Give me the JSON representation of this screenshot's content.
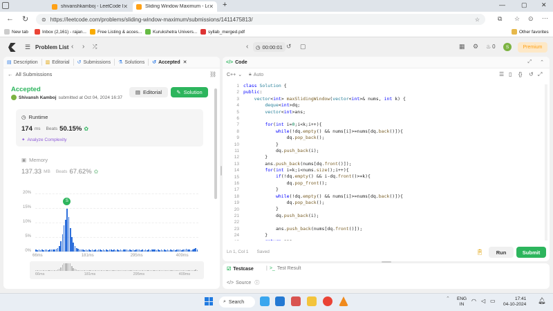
{
  "browser": {
    "tabs": [
      {
        "title": "shivanshkamboj - LeetCode Profi",
        "active": false
      },
      {
        "title": "Sliding Window Maximum - Leetc",
        "active": true
      }
    ],
    "new_tab": "+",
    "url": "https://leetcode.com/problems/sliding-window-maximum/submissions/1411475813/",
    "bookmarks": [
      "New tab",
      "Inbox (2,161) - rajan...",
      "Free Listing & acces...",
      "Kurukshetra Univers...",
      "syllab_merged.pdf"
    ],
    "other_favorites": "Other favorites"
  },
  "lc_header": {
    "problem_list": "Problem List",
    "timer": "00:00:01",
    "coins": "0",
    "premium": "Premium",
    "avatar_letter": "S"
  },
  "left_tabs": [
    "Description",
    "Editorial",
    "Submissions",
    "Solutions",
    "Accepted"
  ],
  "submission": {
    "back_link": "All Submissions",
    "status": "Accepted",
    "user": "Shivansh Kamboj",
    "submitted_at": "submitted at Oct 04, 2024 16:37",
    "editorial_button": "Editorial",
    "solution_button": "Solution",
    "runtime_label": "Runtime",
    "runtime_value": "174",
    "runtime_unit": "ms",
    "beats_label": "Beats",
    "runtime_beats": "50.15%",
    "analyze": "Analyze Complexity",
    "memory_label": "Memory",
    "memory_value": "137.33",
    "memory_unit": "MB",
    "memory_beats": "67.62%"
  },
  "chart_data": {
    "type": "bar",
    "y_ticks": [
      "20%",
      "15%",
      "10%",
      "5%",
      "0%"
    ],
    "x_ticks": [
      "66ms",
      "181ms",
      "295ms",
      "409ms"
    ],
    "mini_x_ticks": [
      "66ms",
      "181ms",
      "295ms",
      "409ms"
    ],
    "ylim": [
      0,
      20
    ],
    "marker_label": "S",
    "values": [
      0.6,
      0.5,
      0.6,
      0.5,
      0.6,
      0.5,
      0.7,
      0.6,
      0.5,
      0.6,
      0.7,
      0.6,
      0.8,
      0.9,
      1.2,
      2,
      3.5,
      6,
      9,
      11,
      14.8,
      12,
      8,
      5,
      3,
      1.8,
      1.2,
      0.9,
      0.8,
      0.6,
      0.7,
      0.5,
      0.6,
      0.5,
      0.6,
      0.5,
      0.6,
      0.5,
      0.6,
      0.5,
      0.6,
      0.7,
      0.5,
      0.6,
      0.5,
      0.6,
      0.5,
      0.6,
      0.7,
      0.5,
      0.6,
      0.5,
      0.6,
      0.5,
      0.6,
      0.5,
      0.6,
      0.7,
      0.6,
      0.5,
      0.6,
      0.5,
      0.6,
      0.5,
      0.6,
      0.7,
      0.6,
      0.5,
      0.6,
      0.5,
      0.6,
      0.5,
      0.6,
      0.5,
      0.6,
      0.7,
      0.6,
      0.5,
      0.6,
      0.5,
      0.6,
      0.5,
      0.6,
      0.5,
      0.6,
      0.5,
      0.6,
      0.5,
      0.6,
      0.5,
      0.6,
      0.7,
      0.6,
      0.5,
      0.6,
      0.8,
      0.9,
      0.7,
      0.6,
      0.5,
      0.6,
      0.9,
      1.1,
      0.8
    ]
  },
  "code_panel": {
    "title": "Code",
    "language": "C++",
    "mode": "Auto",
    "status": "Ln 1, Col 1",
    "saved": "Saved",
    "run": "Run",
    "submit": "Submit",
    "lines": [
      "class Solution {",
      "public:",
      "    vector<int> maxSlidingWindow(vector<int>& nums, int k) {",
      "        deque<int>dq;",
      "        vector<int>ans;",
      "",
      "        for(int i=0;i<k;i++){",
      "            while(!dq.empty() && nums[i]>=nums[dq.back()]){",
      "                dq.pop_back();",
      "            }",
      "            dq.push_back(i);",
      "        }",
      "        ans.push_back(nums[dq.front()]);",
      "        for(int i=k;i<nums.size();i++){",
      "            if(!dq.empty() && i-dq.front()>=k){",
      "                dq.pop_front();",
      "            }",
      "            while(!dq.empty() && nums[i]>=nums[dq.back()]){",
      "                dq.pop_back();",
      "            }",
      "            dq.push_back(i);",
      "",
      "            ans.push_back(nums[dq.front()]);",
      "        }",
      "        return ans;"
    ]
  },
  "bottom_panel": {
    "testcase": "Testcase",
    "test_result": "Test Result",
    "source": "Source"
  },
  "taskbar": {
    "search": "Search",
    "lang_top": "ENG",
    "lang_bottom": "IN",
    "time": "17:41",
    "date": "04-10-2024"
  },
  "colors": {
    "accent_green": "#2db55d",
    "chart_blue": "#2d6fdb",
    "leetcode_orange": "#ffa116"
  }
}
